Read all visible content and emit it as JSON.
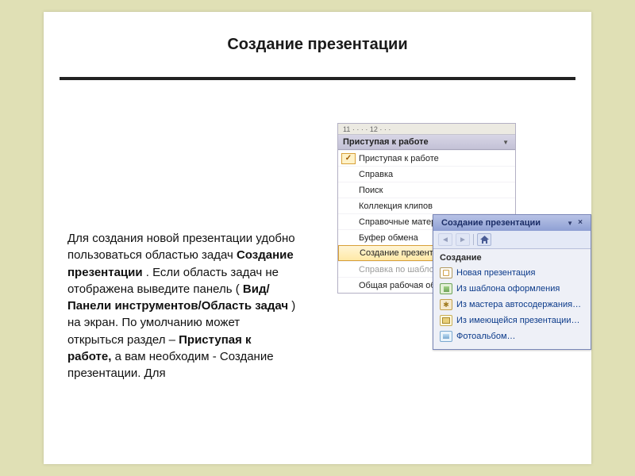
{
  "title": "Создание презентации",
  "body": {
    "t0": "Для создания новой презентации удобно пользоваться областью задач ",
    "b0": "Создание презентации",
    "t1": ". Если область задач не отображена выведите панель (",
    "b1": "Вид/Панели инструментов/Область задач",
    "t2": ") на экран. По умолчанию может открыться раздел – ",
    "b2": "Приступая к работе,",
    "t3": " а вам необходим - Создание презентации. Для"
  },
  "pane1": {
    "ruler": "11 · · · · 12 · · ·",
    "header": "Приступая к работе",
    "items": [
      {
        "label": "Приступая к работе",
        "hl": false,
        "check": true
      },
      {
        "label": "Справка"
      },
      {
        "label": "Поиск"
      },
      {
        "label": "Коллекция клипов"
      },
      {
        "label": "Справочные материалы"
      },
      {
        "label": "Буфер обмена"
      },
      {
        "label": "Создание презентации",
        "hl": true
      },
      {
        "label": "Справка по шаблону",
        "disabled": true
      },
      {
        "label": "Общая рабочая область"
      }
    ]
  },
  "pane2": {
    "title": "Создание презентации",
    "section": "Создание",
    "items": [
      {
        "icon": "doc",
        "label": "Новая презентация"
      },
      {
        "icon": "tpl",
        "label": "Из шаблона оформления"
      },
      {
        "icon": "wiz",
        "label": "Из мастера автосодержания…"
      },
      {
        "icon": "open",
        "label": "Из имеющейся презентации…"
      },
      {
        "icon": "photo",
        "label": "Фотоальбом…"
      }
    ]
  }
}
